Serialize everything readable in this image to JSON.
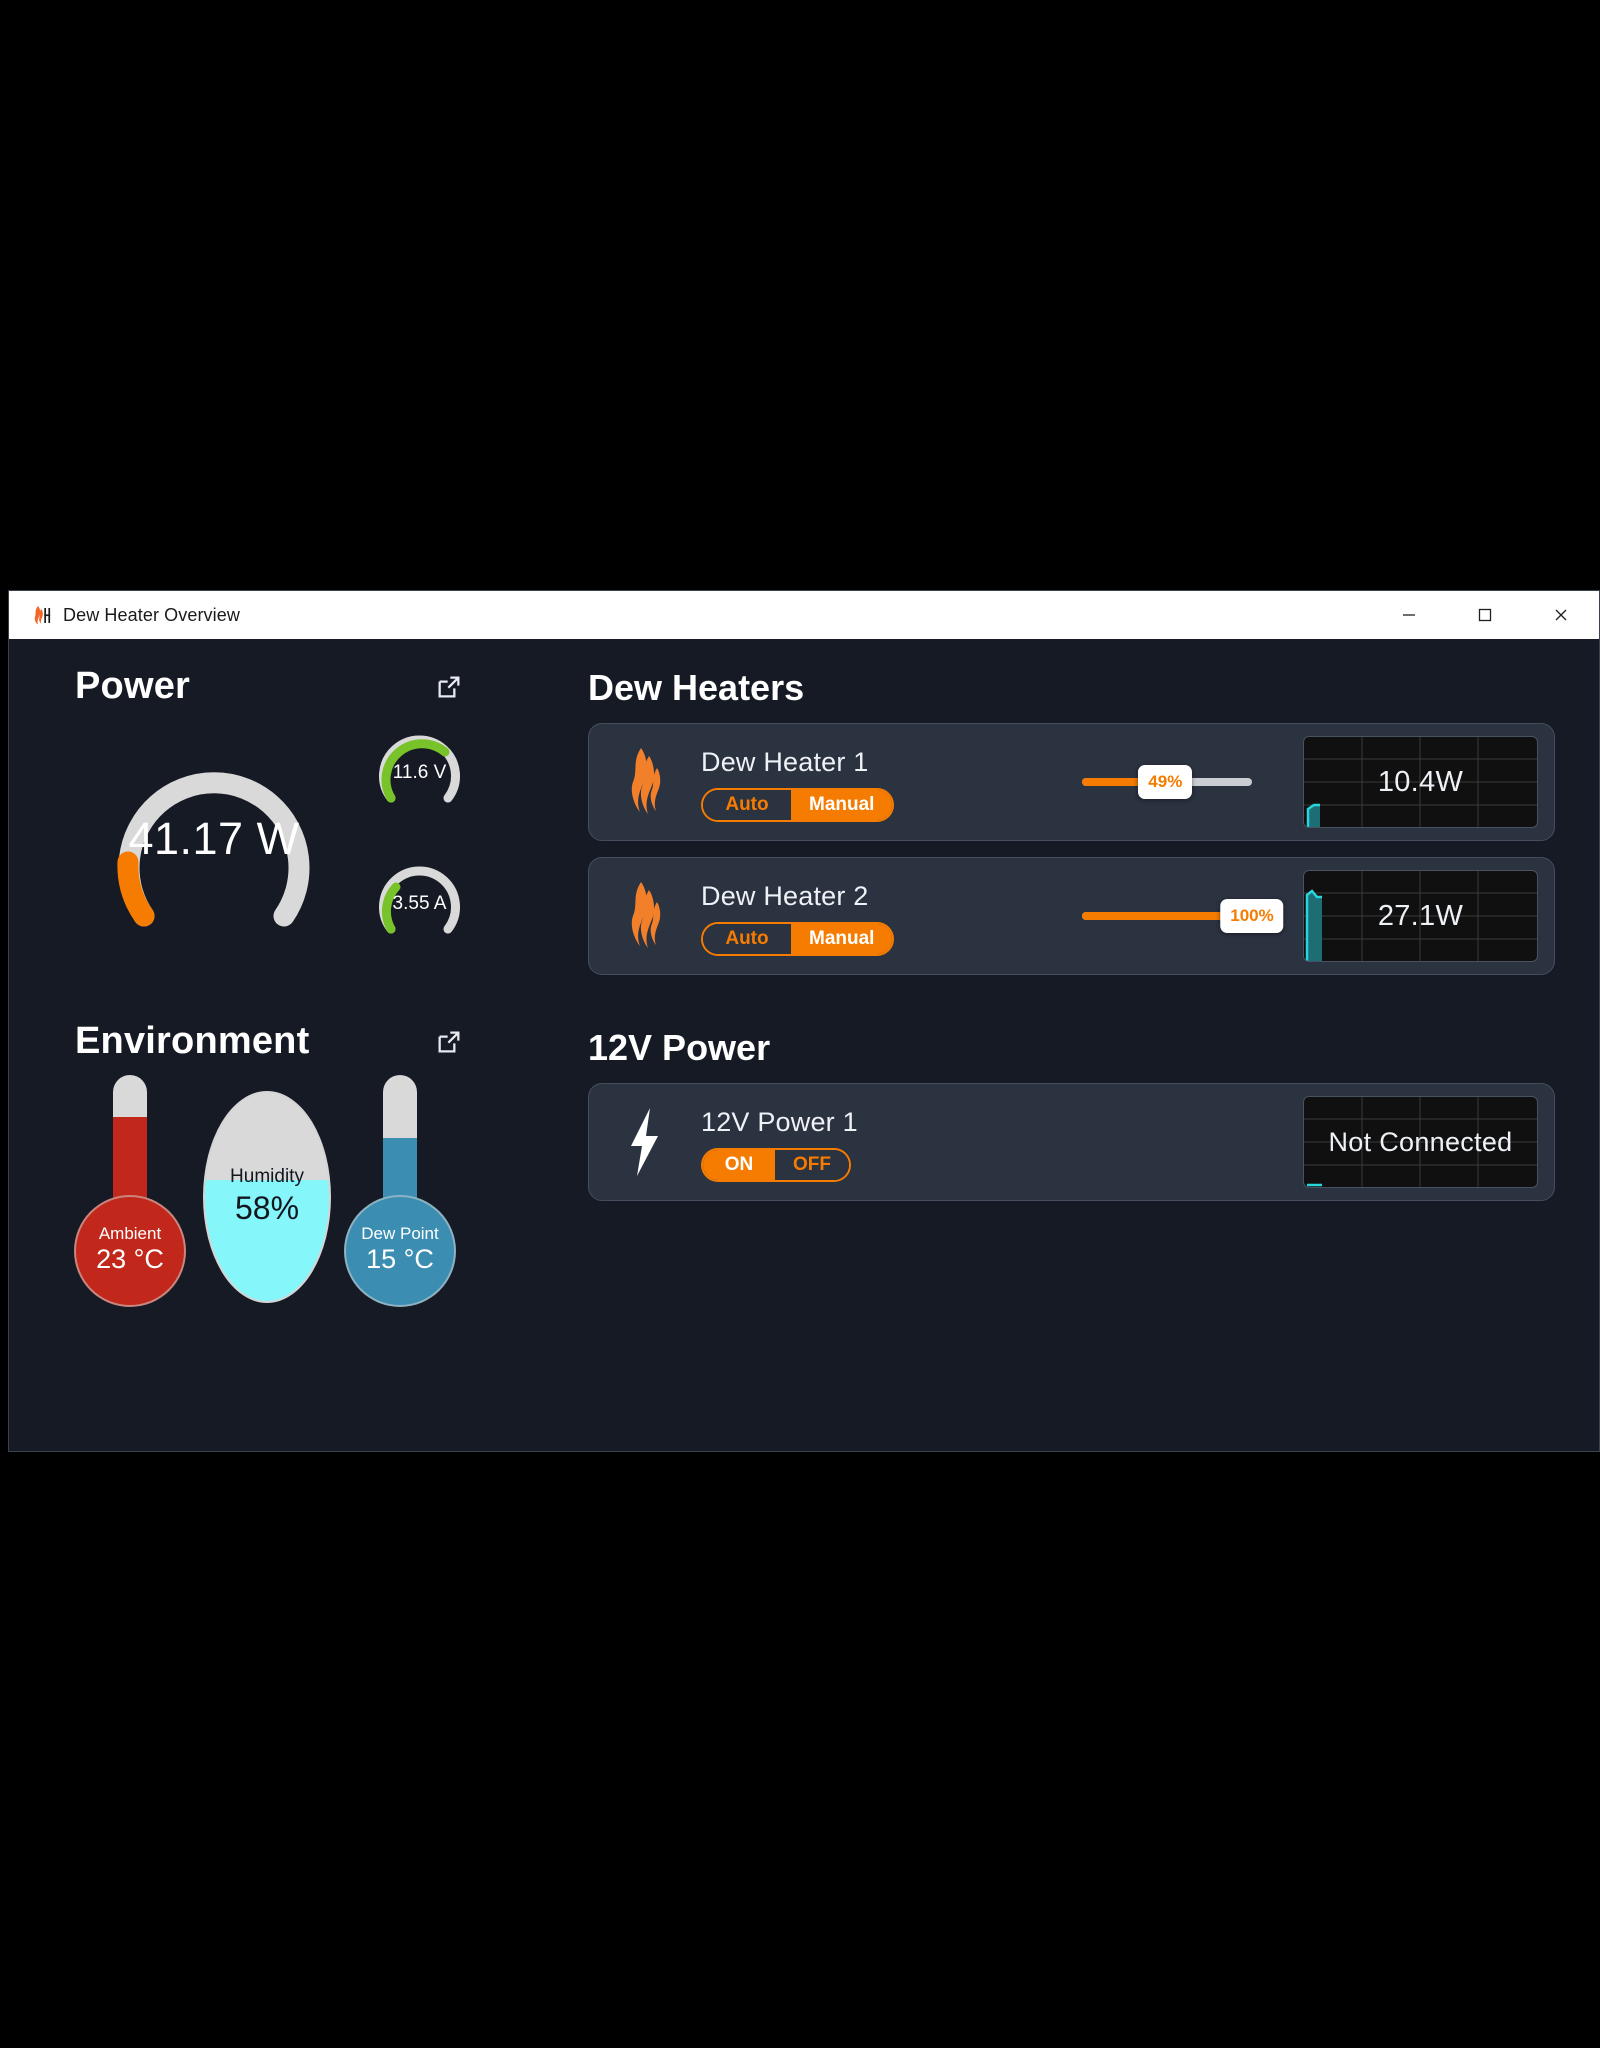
{
  "window": {
    "title": "Dew Heater Overview",
    "app_icon": "flame-icon",
    "minimize_label": "Minimize",
    "maximize_label": "Maximize",
    "close_label": "Close"
  },
  "power_panel": {
    "title": "Power",
    "expand_icon": "external-link-icon",
    "main_gauge": {
      "value": "41.17 W",
      "percent": 18,
      "color": "#f57c00",
      "track_color": "#d9d9d9"
    },
    "mini_gauges": [
      {
        "name": "voltage",
        "value": "11.6 V",
        "percent": 78,
        "color": "#78c32a",
        "track_color": "#d9d9d9"
      },
      {
        "name": "current",
        "value": "3.55 A",
        "percent": 48,
        "color": "#78c32a",
        "track_color": "#d9d9d9"
      }
    ]
  },
  "environment_panel": {
    "title": "Environment",
    "expand_icon": "external-link-icon",
    "ambient": {
      "label": "Ambient",
      "value": "23 °C",
      "color": "#c1281b",
      "fill_percent": 72
    },
    "humidity": {
      "label": "Humidity",
      "value": "58%",
      "color": "#85f6f9",
      "fill_percent": 58
    },
    "dew_point": {
      "label": "Dew Point",
      "value": "15 °C",
      "color": "#3b8db2",
      "fill_percent": 58
    }
  },
  "dew_heaters": {
    "section_title": "Dew Heaters",
    "devices": [
      {
        "icon": "flame-icon",
        "name": "Dew Heater 1",
        "mode_options": [
          "Auto",
          "Manual"
        ],
        "mode_selected": "Manual",
        "slider_value": "49%",
        "slider_percent": 49,
        "chart_value": "10.4W"
      },
      {
        "icon": "flame-icon",
        "name": "Dew Heater 2",
        "mode_options": [
          "Auto",
          "Manual"
        ],
        "mode_selected": "Manual",
        "slider_value": "100%",
        "slider_percent": 100,
        "chart_value": "27.1W"
      }
    ]
  },
  "power_12v": {
    "section_title": "12V Power",
    "devices": [
      {
        "icon": "lightning-bolt-icon",
        "name": "12V Power 1",
        "state_options": [
          "ON",
          "OFF"
        ],
        "state_selected": "ON",
        "chart_value": "Not Connected"
      }
    ]
  },
  "colors": {
    "accent_orange": "#f57c00",
    "gauge_green": "#78c32a",
    "chart_cyan": "#29c6d4",
    "card_bg": "#2b3240",
    "window_bg": "#151a24",
    "hot_red": "#c1281b",
    "cool_blue": "#3b8db2"
  }
}
